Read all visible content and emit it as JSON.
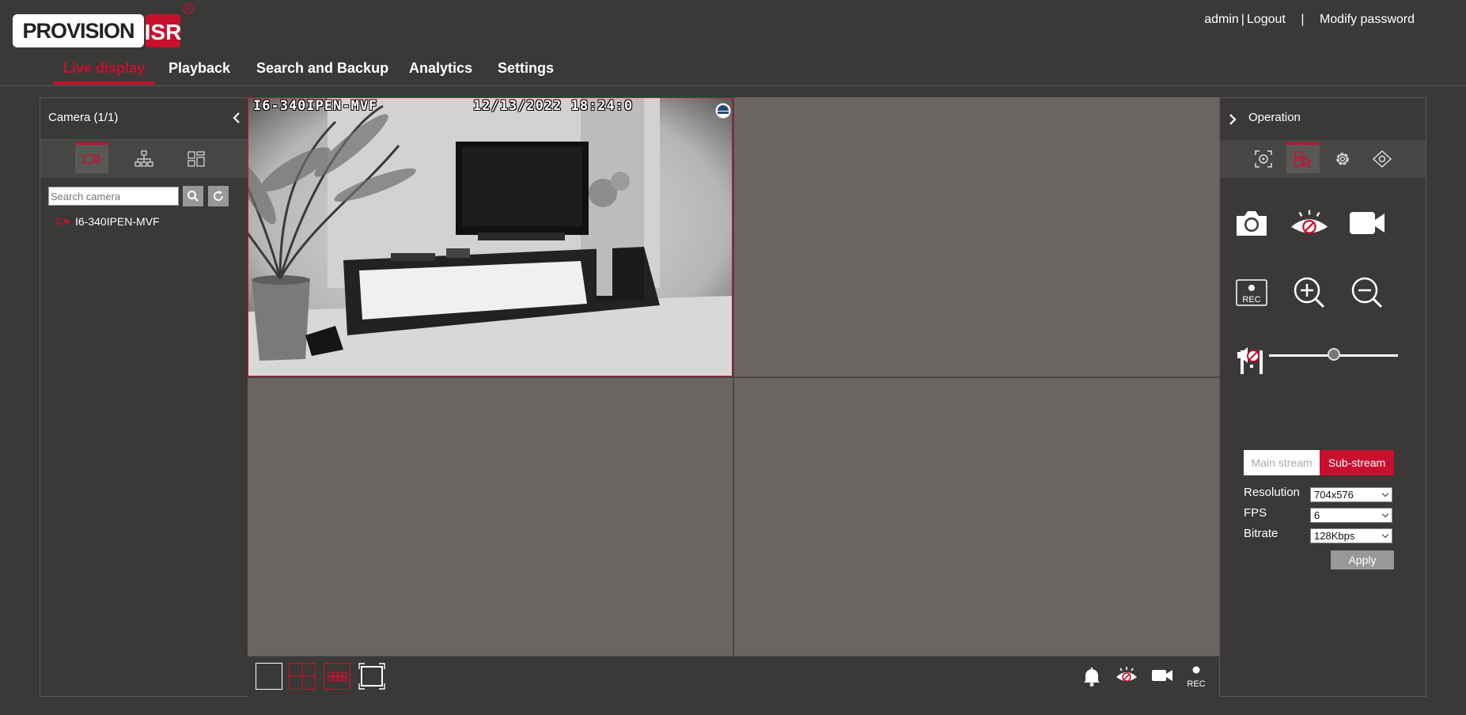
{
  "brand": {
    "logo_text": "PROVISION",
    "logo_suffix": "ISR"
  },
  "header": {
    "user": "admin",
    "logout": "Logout",
    "modify_password": "Modify password",
    "nav": [
      "Live display",
      "Playback",
      "Search and Backup",
      "Analytics",
      "Settings"
    ],
    "active_nav": "Live display"
  },
  "left_panel": {
    "title": "Camera (1/1)",
    "search_placeholder": "Search camera",
    "cameras": [
      {
        "name": "I6-340IPEN-MVF"
      }
    ]
  },
  "video": {
    "osd_name": "I6-340IPEN-MVF",
    "osd_time": "12/13/2022  18:24:0"
  },
  "right_panel": {
    "title": "Operation",
    "volume_level": 0.5,
    "stream": {
      "main": "Main stream",
      "sub": "Sub-stream",
      "selected": "Sub-stream"
    },
    "params": [
      {
        "label": "Resolution",
        "value": "704x576"
      },
      {
        "label": "FPS",
        "value": "6"
      },
      {
        "label": "Bitrate",
        "value": "128Kbps"
      }
    ],
    "apply": "Apply",
    "ratio_label": "1:1",
    "rec_label": "REC"
  },
  "bottom": {
    "rec_label": "REC"
  },
  "colors": {
    "accent": "#c8102e",
    "background": "#3b3937",
    "grid": "#6a6563"
  }
}
